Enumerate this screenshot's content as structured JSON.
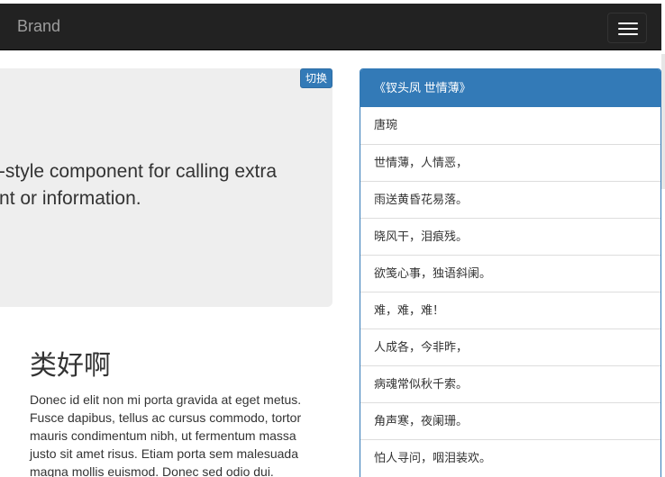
{
  "navbar": {
    "brand": "Brand",
    "toggle_icon": "hamburger-icon"
  },
  "jumbotron": {
    "toggle_button": "切换",
    "text": "This is a simple jumbotron-style component for calling extra attention to featured content or information."
  },
  "main": {
    "heading": "类好啊",
    "paragraph": "Donec id elit non mi porta gravida at eget metus. Fusce dapibus, tellus ac cursus commodo, tortor mauris condimentum nibh, ut fermentum massa justo sit amet risus. Etiam porta sem malesuada magna mollis euismod. Donec sed odio dui."
  },
  "sidebar": {
    "title": "《钗头凤 世情薄》",
    "items": [
      "唐琬",
      "世情薄，人情恶，",
      "雨送黄昏花易落。",
      "晓风干，泪痕残。",
      "欲笺心事，独语斜阑。",
      "难，难，难！",
      "人成各，今非昨，",
      "病魂常似秋千索。",
      "角声寒，夜阑珊。",
      "怕人寻问，咽泪装欢。"
    ]
  },
  "colors": {
    "navbar_bg": "#222222",
    "brand_text": "#9d9d9d",
    "primary": "#337ab7",
    "jumbotron_bg": "#eeeeee"
  }
}
